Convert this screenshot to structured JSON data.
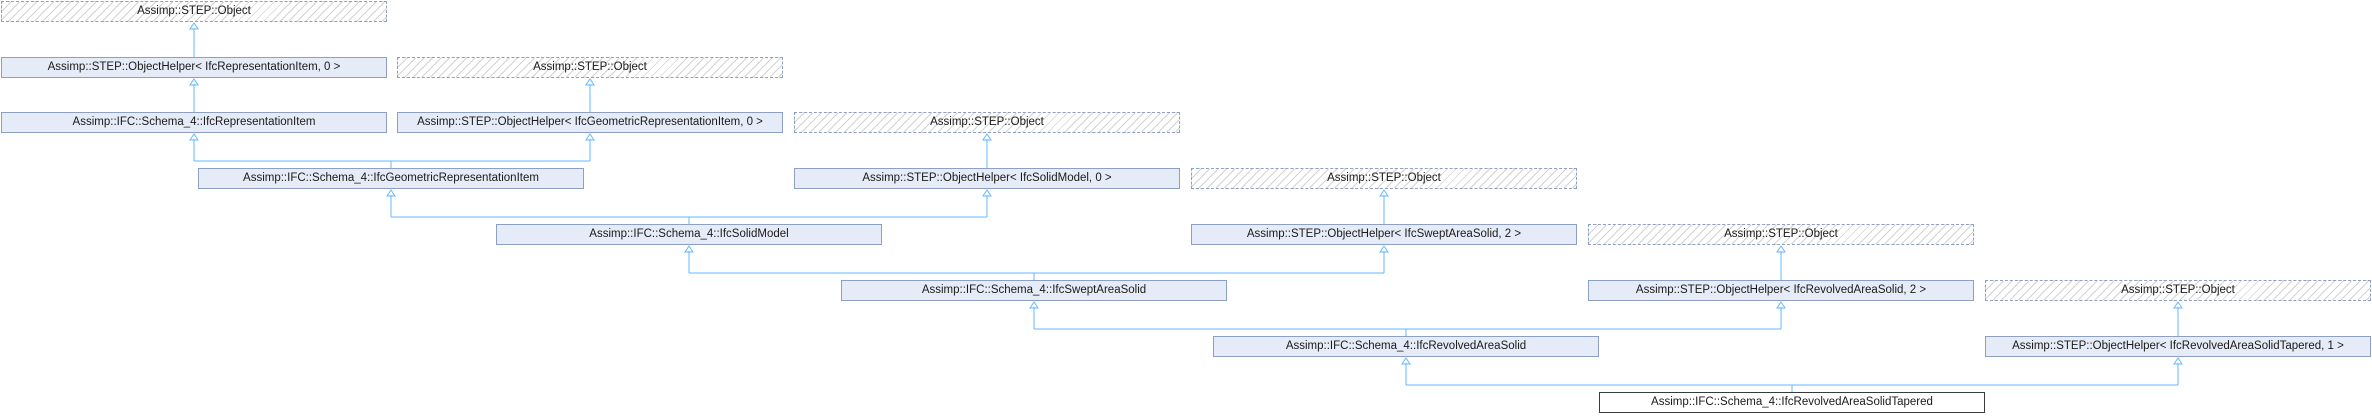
{
  "diagram": {
    "title": "",
    "edge_color": "#63b8ff",
    "nodes": [
      {
        "id": "o1",
        "label": "Assimp::STEP::Object",
        "kind": "external"
      },
      {
        "id": "oh_rep",
        "label": "Assimp::STEP::ObjectHelper< IfcRepresentationItem, 0 >",
        "kind": "normal"
      },
      {
        "id": "o2",
        "label": "Assimp::STEP::Object",
        "kind": "external"
      },
      {
        "id": "rep",
        "label": "Assimp::IFC::Schema_4::IfcRepresentationItem",
        "kind": "normal"
      },
      {
        "id": "oh_geo",
        "label": "Assimp::STEP::ObjectHelper< IfcGeometricRepresentationItem, 0 >",
        "kind": "normal"
      },
      {
        "id": "o3",
        "label": "Assimp::STEP::Object",
        "kind": "external"
      },
      {
        "id": "geo",
        "label": "Assimp::IFC::Schema_4::IfcGeometricRepresentationItem",
        "kind": "normal"
      },
      {
        "id": "oh_solid",
        "label": "Assimp::STEP::ObjectHelper< IfcSolidModel, 0 >",
        "kind": "normal"
      },
      {
        "id": "o4",
        "label": "Assimp::STEP::Object",
        "kind": "external"
      },
      {
        "id": "solid",
        "label": "Assimp::IFC::Schema_4::IfcSolidModel",
        "kind": "normal"
      },
      {
        "id": "oh_swept",
        "label": "Assimp::STEP::ObjectHelper< IfcSweptAreaSolid, 2 >",
        "kind": "normal"
      },
      {
        "id": "o5",
        "label": "Assimp::STEP::Object",
        "kind": "external"
      },
      {
        "id": "swept",
        "label": "Assimp::IFC::Schema_4::IfcSweptAreaSolid",
        "kind": "normal"
      },
      {
        "id": "oh_rev",
        "label": "Assimp::STEP::ObjectHelper< IfcRevolvedAreaSolid, 2 >",
        "kind": "normal"
      },
      {
        "id": "o6",
        "label": "Assimp::STEP::Object",
        "kind": "external"
      },
      {
        "id": "rev",
        "label": "Assimp::IFC::Schema_4::IfcRevolvedAreaSolid",
        "kind": "normal"
      },
      {
        "id": "oh_tap",
        "label": "Assimp::STEP::ObjectHelper< IfcRevolvedAreaSolidTapered, 1 >",
        "kind": "normal"
      },
      {
        "id": "tap",
        "label": "Assimp::IFC::Schema_4::IfcRevolvedAreaSolidTapered",
        "kind": "focus"
      }
    ],
    "edges": [
      {
        "from": "o1",
        "to": "oh_rep"
      },
      {
        "from": "oh_rep",
        "to": "rep"
      },
      {
        "from": "o2",
        "to": "oh_geo"
      },
      {
        "from": "rep",
        "to": "geo"
      },
      {
        "from": "oh_geo",
        "to": "geo"
      },
      {
        "from": "o3",
        "to": "oh_solid"
      },
      {
        "from": "geo",
        "to": "solid"
      },
      {
        "from": "oh_solid",
        "to": "solid"
      },
      {
        "from": "o4",
        "to": "oh_swept"
      },
      {
        "from": "solid",
        "to": "swept"
      },
      {
        "from": "oh_swept",
        "to": "swept"
      },
      {
        "from": "o5",
        "to": "oh_rev"
      },
      {
        "from": "swept",
        "to": "rev"
      },
      {
        "from": "oh_rev",
        "to": "rev"
      },
      {
        "from": "o6",
        "to": "oh_tap"
      },
      {
        "from": "rev",
        "to": "tap"
      },
      {
        "from": "oh_tap",
        "to": "tap"
      }
    ]
  }
}
